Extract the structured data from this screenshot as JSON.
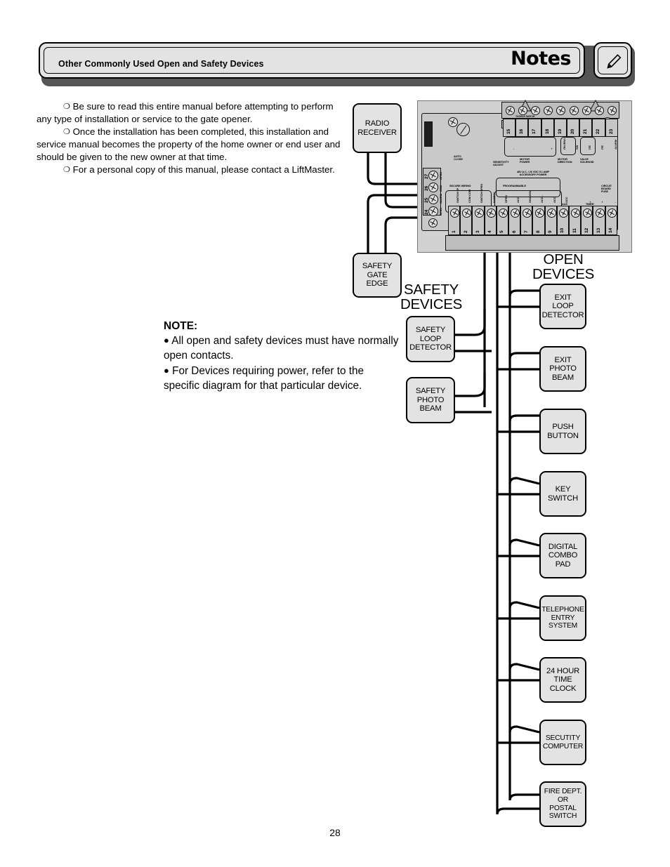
{
  "header": {
    "section_title": "Other Commonly Used Open and Safety Devices",
    "notes_label": "Notes",
    "pencil_icon": "pencil-icon"
  },
  "intro": {
    "bullet_glyph": "❍",
    "paragraphs": [
      "Be sure to read this entire manual before attempting to perform any type of installation or service to the gate opener.",
      "Once the installation has been completed, this installation and service manual becomes the property of the home owner or end user and should be given to the new owner at that time.",
      "For a personal copy of this manual, please contact a LiftMaster."
    ]
  },
  "note": {
    "heading": "NOTE:",
    "bullet_glyph": "●",
    "items": [
      "All open and safety devices must have normally open contacts.",
      "For Devices requiring power, refer to the specific diagram for that particular device."
    ]
  },
  "diagram": {
    "group_labels": {
      "safety": "SAFETY\nDEVICES",
      "open": "OPEN\nDEVICES"
    },
    "radio_receiver": "RADIO\nRECEIVER",
    "safety_devices": [
      "SAFETY\nGATE\nEDGE",
      "SAFETY\nLOOP\nDETECTOR",
      "SAFETY\nPHOTO\nBEAM"
    ],
    "open_devices": [
      "EXIT\nLOOP\nDETECTOR",
      "EXIT\nPHOTO\nBEAM",
      "PUSH\nBUTTON",
      "KEY\nSWITCH",
      "DIGITAL\nCOMBO\nPAD",
      "TELEPHONE\nENTRY\nSYSTEM",
      "24 HOUR\nTIME\nCLOCK",
      "SECUTITY\nCOMPUTER",
      "FIRE DEPT.\nOR\nPOSTAL\nSWITCH"
    ]
  },
  "pcb": {
    "bottom_terminal_numbers": [
      "1",
      "2",
      "3",
      "4",
      "5",
      "6",
      "7",
      "8",
      "9",
      "10",
      "11",
      "12",
      "13",
      "14"
    ],
    "bottom_terminal_labels": [
      "SWITCH\nSP",
      "COM\nCOM",
      "SWITCH\nOPEN",
      "SAFETY",
      "OPEN",
      "ACC",
      "SHADOW",
      "ACC\n-",
      "ACC",
      "ACC",
      "",
      "+",
      "+",
      "-"
    ],
    "top_terminal_numbers": [
      "15",
      "16",
      "17",
      "18",
      "19",
      "20",
      "21",
      "22",
      "23"
    ],
    "top_terminal_labels": [
      "-",
      "",
      "",
      "+",
      "ON\n/ENA",
      "SW",
      "ITE",
      "ITE",
      "ALARM"
    ],
    "left_terminal_numbers": [
      "24",
      "25",
      "26",
      "27"
    ],
    "left_terminal_labels": [
      "OPEN",
      "ALARM",
      "COM",
      "OPEN"
    ],
    "annotations": [
      "AUTO\nCLOSE",
      "SENSITIVITY\nADJUST",
      "MOTOR\nPOWER",
      "MOTOR\nDIRECTION",
      "VALVE\nSOLENOID",
      "48V A.C. / 26 VDC 5.1 AMP\nACCESSORY POWER",
      "ACCESSORY",
      "PROGRAMMABLE",
      "SECURE WIRING",
      "AUX\nRELAY",
      "TIMER\nCLOSE",
      "CIRCUIT\nBOARD\nFUSE",
      "OFF ON",
      "TOGGLE SWITCH"
    ]
  },
  "page_number": "28"
}
